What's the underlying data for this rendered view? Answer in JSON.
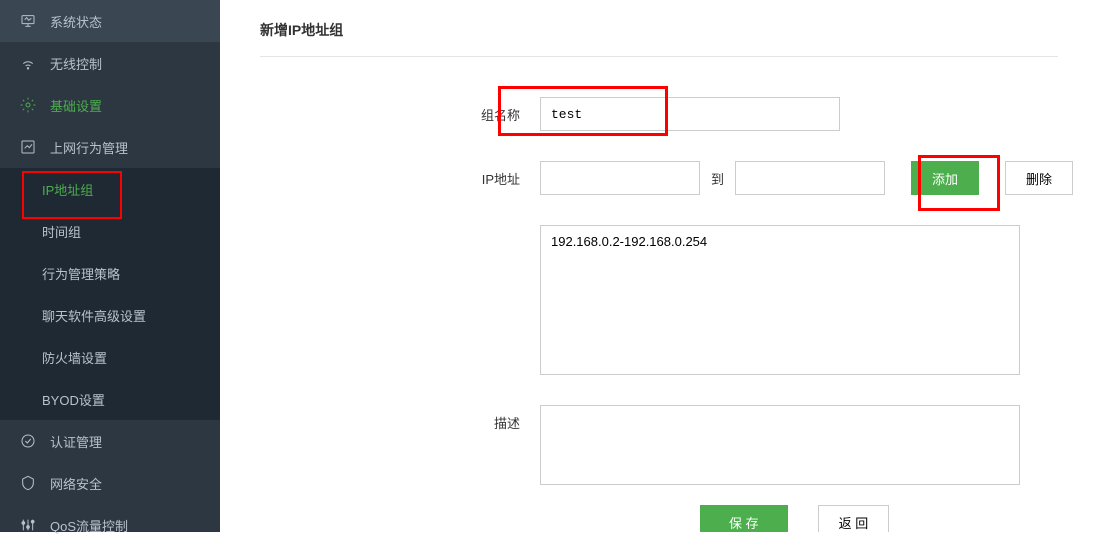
{
  "sidebar": {
    "items": [
      {
        "label": "系统状态",
        "icon": "monitor"
      },
      {
        "label": "无线控制",
        "icon": "wifi"
      },
      {
        "label": "基础设置",
        "icon": "gear",
        "active": true
      },
      {
        "label": "上网行为管理",
        "icon": "chart"
      },
      {
        "label": "认证管理",
        "icon": "check-circle"
      },
      {
        "label": "网络安全",
        "icon": "shield"
      },
      {
        "label": "QoS流量控制",
        "icon": "sliders"
      }
    ],
    "subitems": [
      {
        "label": "IP地址组",
        "active": true
      },
      {
        "label": "时间组"
      },
      {
        "label": "行为管理策略"
      },
      {
        "label": "聊天软件高级设置"
      },
      {
        "label": "防火墙设置"
      },
      {
        "label": "BYOD设置"
      }
    ]
  },
  "page": {
    "title": "新增IP地址组"
  },
  "form": {
    "group_name_label": "组名称",
    "group_name_value": "test",
    "ip_address_label": "IP地址",
    "ip_start_value": "",
    "to_label": "到",
    "ip_end_value": "",
    "add_button": "添加",
    "delete_button": "删除",
    "ip_list_value": "192.168.0.2-192.168.0.254",
    "description_label": "描述",
    "description_value": "",
    "save_button": "保 存",
    "back_button": "返 回"
  }
}
